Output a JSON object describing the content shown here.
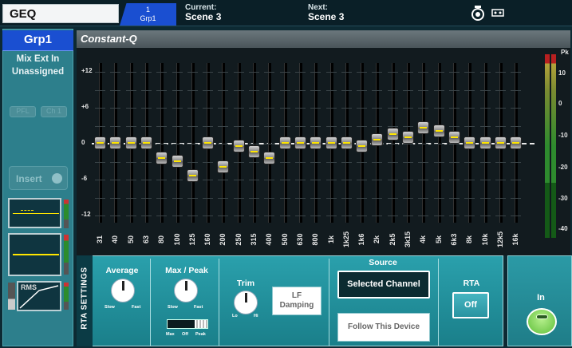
{
  "window": {
    "title": "GEQ"
  },
  "group_tab": {
    "number": "1",
    "name": "Grp1"
  },
  "scenes": {
    "current_label": "Current:",
    "current_value": "Scene 3",
    "next_label": "Next:",
    "next_value": "Scene 3"
  },
  "sidebar": {
    "group": "Grp1",
    "line1": "Mix Ext In",
    "line2": "Unassigned",
    "ghost1": "PFL",
    "ghost2": "Ch 1",
    "insert_label": "Insert",
    "rms_label": "RMS"
  },
  "geq": {
    "mode": "Constant-Q",
    "y_labels": [
      "+12",
      "+6",
      "0",
      "-6",
      "-12"
    ],
    "bands": [
      {
        "freq": "31",
        "gain": 0
      },
      {
        "freq": "40",
        "gain": 0
      },
      {
        "freq": "50",
        "gain": 0
      },
      {
        "freq": "63",
        "gain": 0
      },
      {
        "freq": "80",
        "gain": -2.5
      },
      {
        "freq": "100",
        "gain": -3
      },
      {
        "freq": "125",
        "gain": -5.5
      },
      {
        "freq": "160",
        "gain": 0
      },
      {
        "freq": "200",
        "gain": -4
      },
      {
        "freq": "250",
        "gain": -0.5
      },
      {
        "freq": "315",
        "gain": -1.5
      },
      {
        "freq": "400",
        "gain": -2.5
      },
      {
        "freq": "500",
        "gain": 0
      },
      {
        "freq": "630",
        "gain": 0
      },
      {
        "freq": "800",
        "gain": 0
      },
      {
        "freq": "1k",
        "gain": 0
      },
      {
        "freq": "1k25",
        "gain": 0
      },
      {
        "freq": "1k6",
        "gain": -0.5
      },
      {
        "freq": "2k",
        "gain": 0.5
      },
      {
        "freq": "2k5",
        "gain": 1.5
      },
      {
        "freq": "3k15",
        "gain": 1
      },
      {
        "freq": "4k",
        "gain": 2.5
      },
      {
        "freq": "5k",
        "gain": 2
      },
      {
        "freq": "6k3",
        "gain": 1
      },
      {
        "freq": "8k",
        "gain": 0
      },
      {
        "freq": "10k",
        "gain": 0
      },
      {
        "freq": "12k5",
        "gain": 0
      },
      {
        "freq": "16k",
        "gain": 0
      }
    ]
  },
  "meter": {
    "labels": [
      "Pk",
      "10",
      "0",
      "-10",
      "-20",
      "-30",
      "-40"
    ]
  },
  "rta": {
    "title": "RTA SETTINGS",
    "average": {
      "label": "Average",
      "min": "Slow",
      "max": "Fast"
    },
    "maxpeak": {
      "label": "Max / Peak",
      "min": "Slow",
      "max": "Fast",
      "switch_labels": [
        "Max",
        "Off",
        "Peak"
      ]
    },
    "trim": {
      "label": "Trim",
      "min": "Lo",
      "max": "Hi"
    },
    "lf_damping": {
      "label_line1": "LF",
      "label_line2": "Damping"
    },
    "source": {
      "label": "Source",
      "selected": "Selected Channel",
      "alt": "Follow This Device"
    },
    "rta_toggle": {
      "label": "RTA",
      "value": "Off"
    }
  },
  "in_button": {
    "label": "In"
  },
  "colors": {
    "accent_blue": "#1a4fd1",
    "teal": "#2aa0ac",
    "eq_line": "#ffe600",
    "in_green": "#7ad35a"
  }
}
